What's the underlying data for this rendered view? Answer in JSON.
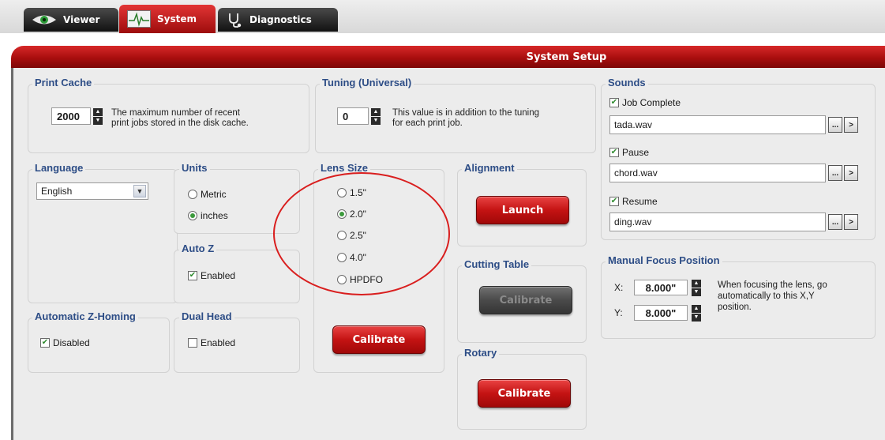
{
  "tabs": [
    {
      "label": "Viewer",
      "icon": "eye-icon",
      "active": false
    },
    {
      "label": "System",
      "icon": "pulse-chart-icon",
      "active": true
    },
    {
      "label": "Diagnostics",
      "icon": "stethoscope-icon",
      "active": false
    }
  ],
  "setup_title": "System Setup",
  "print_cache": {
    "title": "Print Cache",
    "value": "2000",
    "desc_line1": "The maximum number of recent",
    "desc_line2": "print jobs stored in the disk cache."
  },
  "tuning": {
    "title": "Tuning (Universal)",
    "value": "0",
    "desc_line1": "This value is in addition to the tuning",
    "desc_line2": "for each print job."
  },
  "sounds": {
    "title": "Sounds",
    "items": [
      {
        "label": "Job Complete",
        "checked": true,
        "file": "tada.wav"
      },
      {
        "label": "Pause",
        "checked": true,
        "file": "chord.wav"
      },
      {
        "label": "Resume",
        "checked": true,
        "file": "ding.wav"
      }
    ],
    "browse_label": "...",
    "play_label": ">"
  },
  "language": {
    "title": "Language",
    "selected": "English"
  },
  "units": {
    "title": "Units",
    "options": [
      "Metric",
      "inches"
    ],
    "selected": "inches"
  },
  "auto_z": {
    "title": "Auto Z",
    "checkbox_label": "Enabled",
    "checked": true
  },
  "dual_head": {
    "title": "Dual Head",
    "checkbox_label": "Enabled",
    "checked": false
  },
  "auto_z_homing": {
    "title": "Automatic Z-Homing",
    "checkbox_label": "Disabled",
    "checked": true
  },
  "lens_size": {
    "title": "Lens Size",
    "options": [
      "1.5\"",
      "2.0\"",
      "2.5\"",
      "4.0\"",
      "HPDFO"
    ],
    "selected": "2.0\"",
    "button_label": "Calibrate"
  },
  "alignment": {
    "title": "Alignment",
    "button_label": "Launch"
  },
  "cutting_table": {
    "title": "Cutting Table",
    "button_label": "Calibrate",
    "enabled": false
  },
  "rotary": {
    "title": "Rotary",
    "button_label": "Calibrate"
  },
  "manual_focus": {
    "title": "Manual Focus Position",
    "x_label": "X:",
    "y_label": "Y:",
    "x_value": "8.000\"",
    "y_value": "8.000\"",
    "desc_line1": "When focusing the lens, go",
    "desc_line2": "automatically to this X,Y",
    "desc_line3": "position."
  },
  "colors": {
    "accent_red": "#c41313",
    "title_blue": "#2d4d86",
    "annotation_red": "#d91e1e"
  }
}
